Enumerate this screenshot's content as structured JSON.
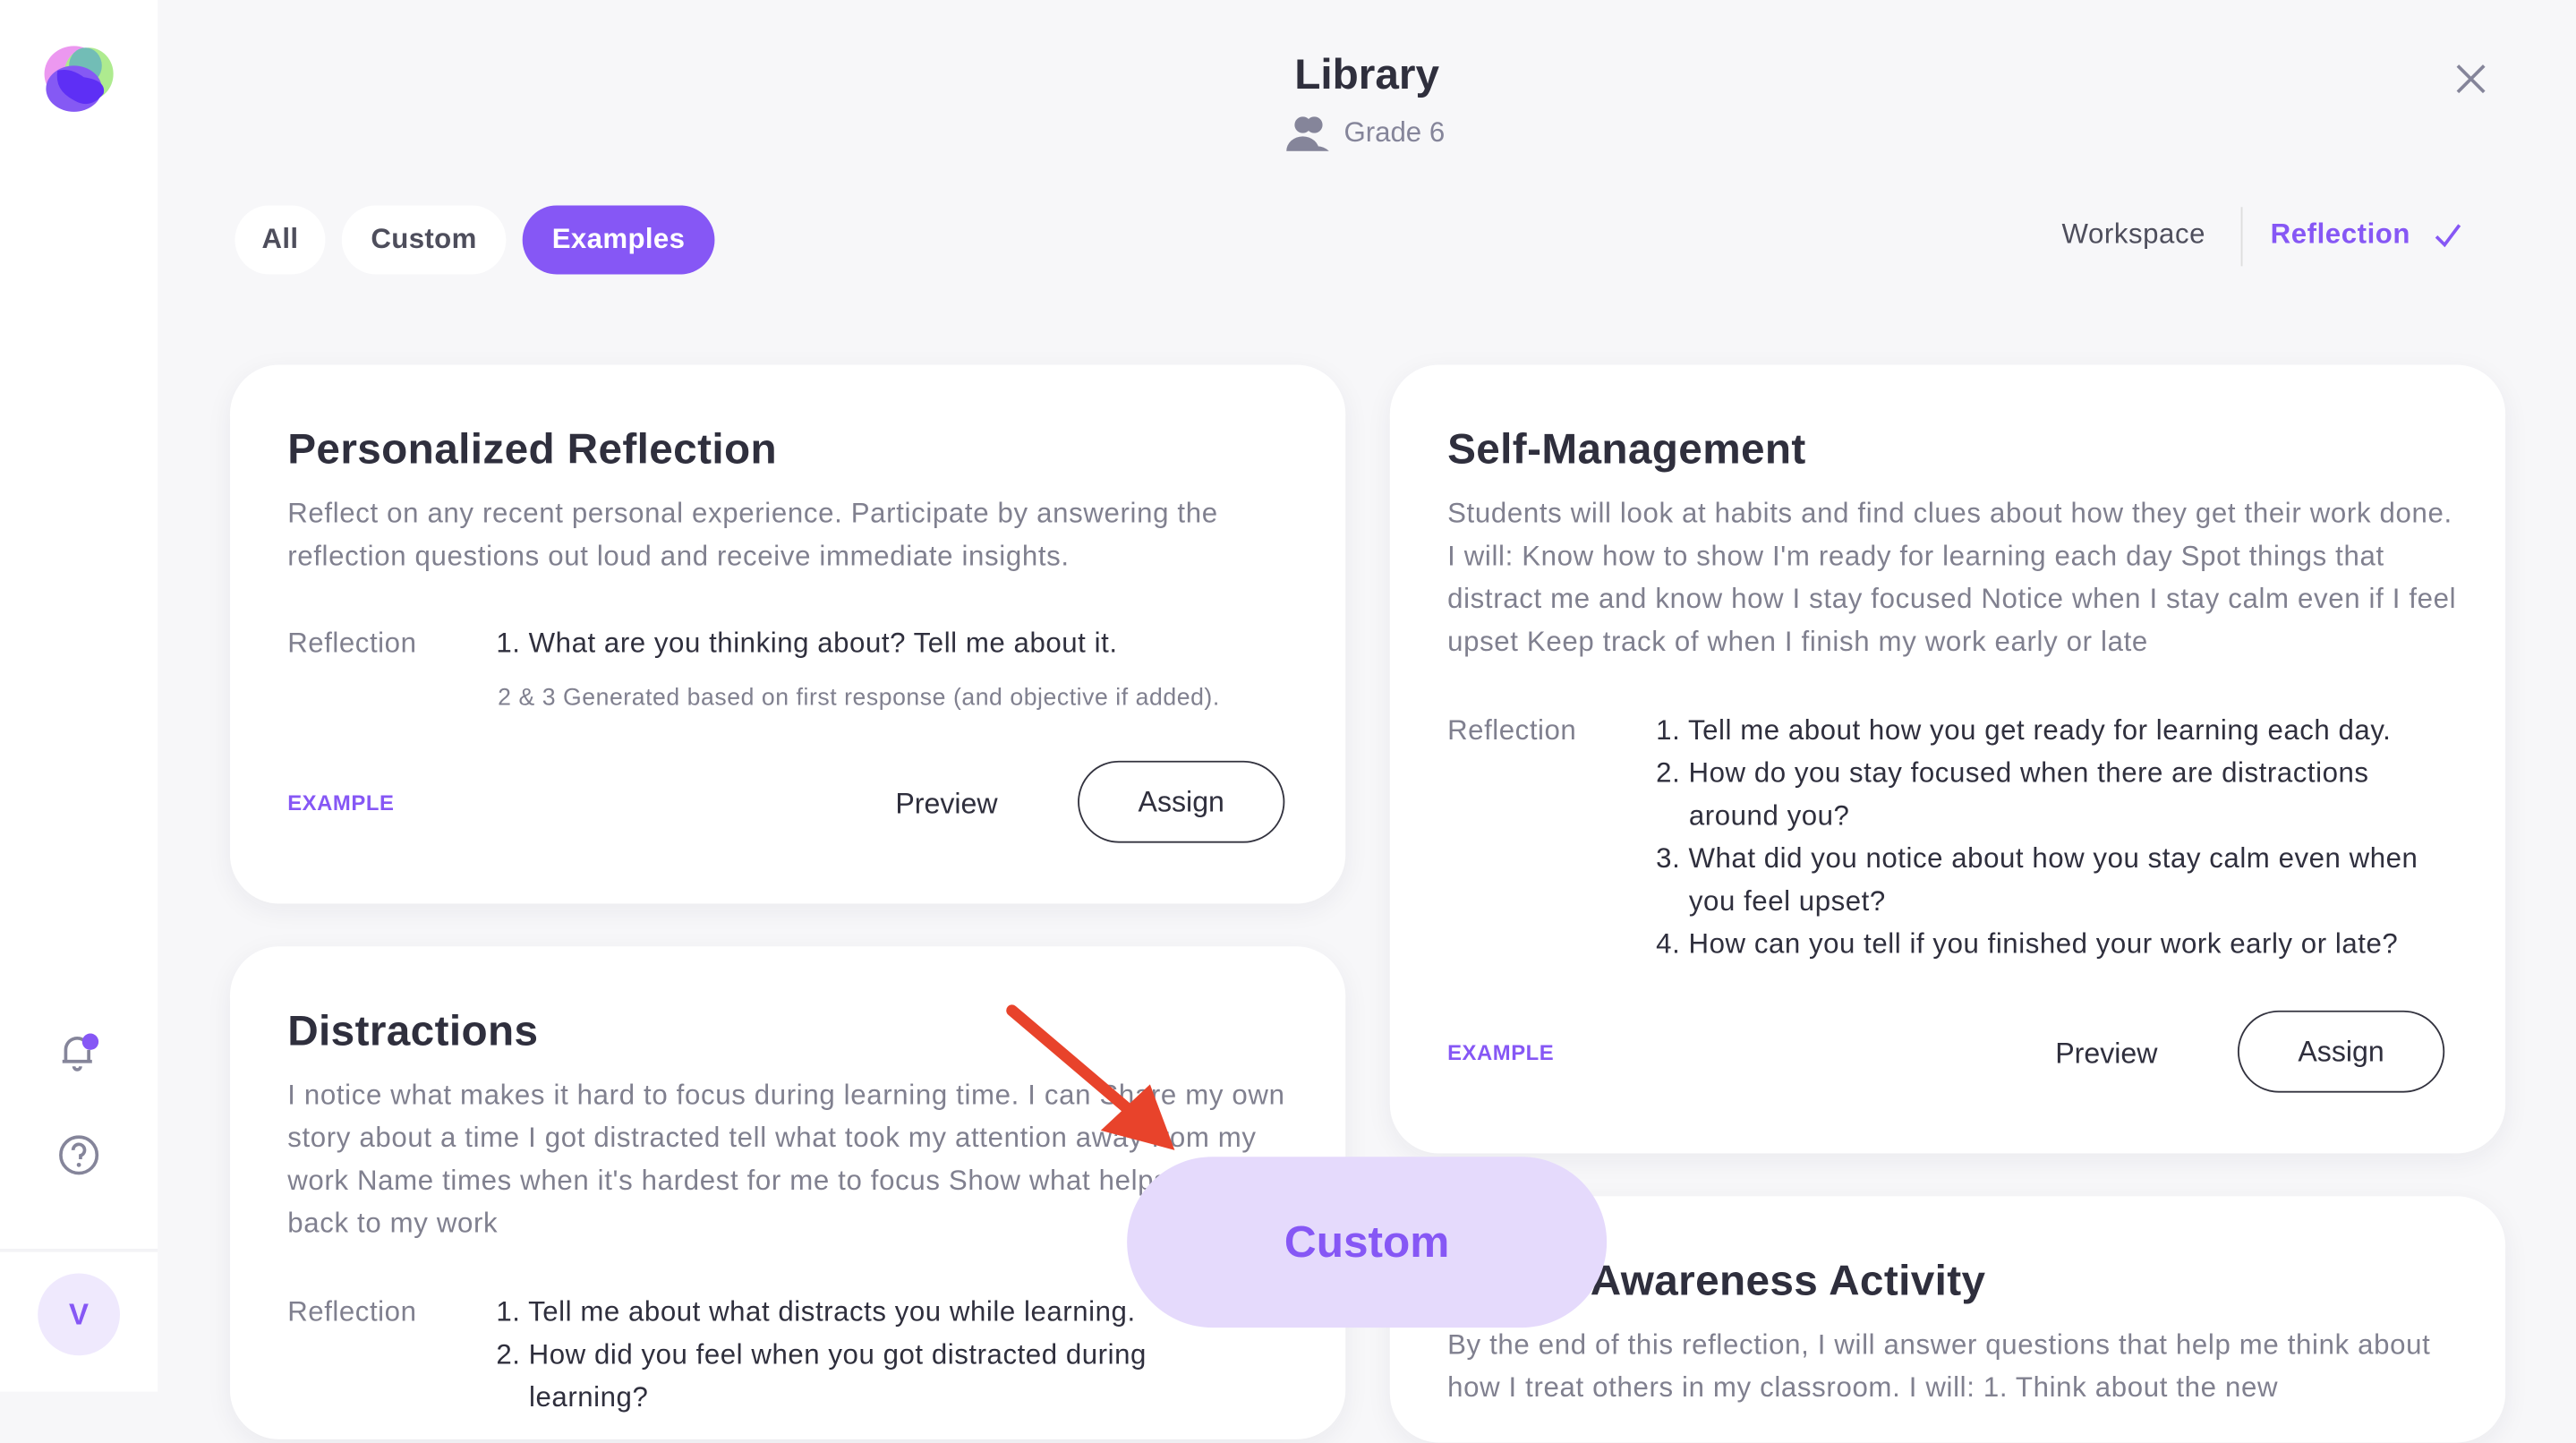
{
  "header": {
    "title": "Library",
    "grade": "Grade 6",
    "close_icon": "close-icon"
  },
  "sidebar": {
    "avatar_initial": "V",
    "icons": [
      "logo",
      "bell-icon",
      "help-icon"
    ]
  },
  "tabs": [
    {
      "label": "All",
      "active": false
    },
    {
      "label": "Custom",
      "active": false
    },
    {
      "label": "Examples",
      "active": true
    }
  ],
  "mode": {
    "workspace": "Workspace",
    "reflection": "Reflection",
    "selected": "Reflection"
  },
  "colors": {
    "accent": "#8657f5",
    "overlay": "#e5dafc",
    "arrow": "#e8432b"
  },
  "cards": [
    {
      "title": "Personalized Reflection",
      "description": "Reflect on any recent personal experience. Participate by answering the reflection questions out loud and receive immediate insights.",
      "reflection_label": "Reflection",
      "questions": [
        "1. What are you thinking about? Tell me about it."
      ],
      "note": "2 & 3 Generated based on first response (and objective if added).",
      "tag": "EXAMPLE",
      "preview": "Preview",
      "assign": "Assign"
    },
    {
      "title": "Distractions",
      "description": "I notice what makes it hard to focus during learning time. I can Share my own story about a time I got distracted tell what took my attention away from my work Name times when it's hardest for me to focus Show what helps me get back to my work",
      "reflection_label": "Reflection",
      "questions": [
        "1. Tell me about what distracts you while learning.",
        "2. How did you feel when you got distracted during learning?"
      ]
    },
    {
      "title": "Self-Management",
      "description": "Students will look at habits and find clues about how they get their work done. I will: Know how to show I'm ready for learning each day Spot things that distract me and know how I stay focused Notice when I stay calm even if I feel upset Keep track of when I finish my work early or late",
      "reflection_label": "Reflection",
      "questions": [
        "1. Tell me about how you get ready for learning each day.",
        "2. How do you stay focused when there are distractions around you?",
        "3. What did you notice about how you stay calm even when you feel upset?",
        "4. How can you tell if you finished your work early or late?"
      ],
      "tag": "EXAMPLE",
      "preview": "Preview",
      "assign": "Assign"
    },
    {
      "title": "Awareness Activity",
      "description": "By the end of this reflection, I will answer questions that help me think about how I treat others in my classroom. I will: 1. Think about the new"
    }
  ],
  "overlay": {
    "label": "Custom"
  }
}
